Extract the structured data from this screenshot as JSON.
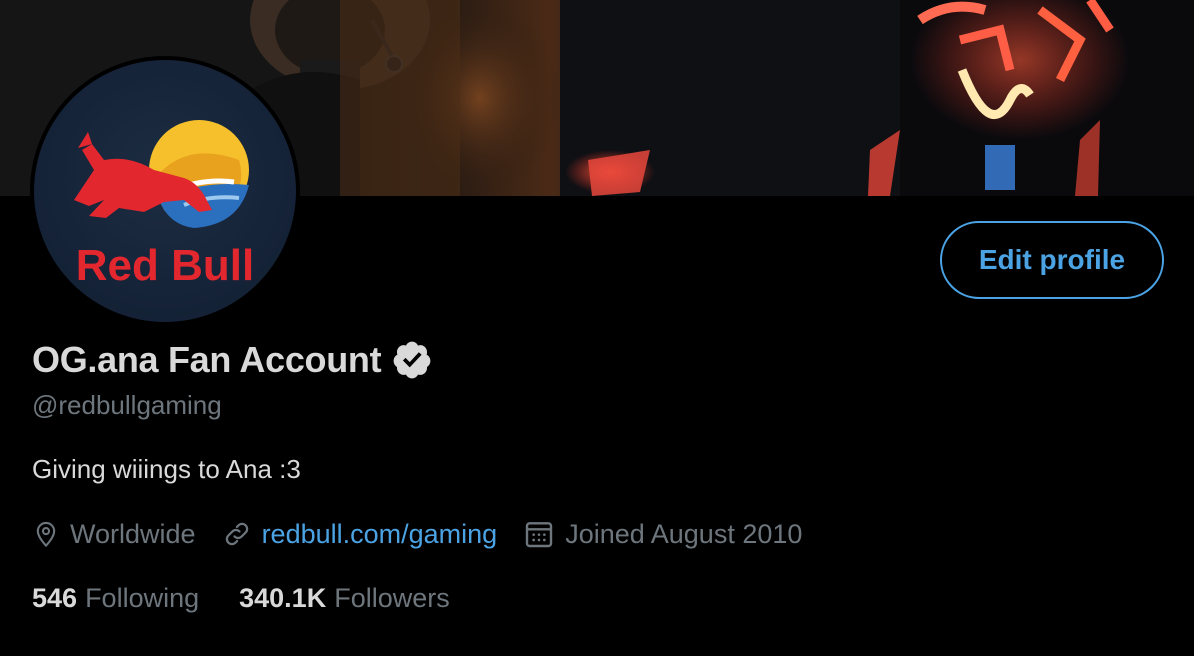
{
  "profile": {
    "display_name": "OG.ana Fan Account",
    "handle": "@redbullgaming",
    "bio": "Giving wiiings to Ana :3",
    "verified": true,
    "avatar_logo_text": "Red Bull"
  },
  "actions": {
    "edit_profile_label": "Edit profile"
  },
  "meta": {
    "location": "Worldwide",
    "website": "redbull.com/gaming",
    "joined": "Joined August 2010"
  },
  "stats": {
    "following_count": "546",
    "following_label": "Following",
    "followers_count": "340.1K",
    "followers_label": "Followers"
  },
  "icons": {
    "location": "map-pin-icon",
    "link": "link-icon",
    "calendar": "calendar-icon",
    "verified": "verified-badge-icon"
  },
  "colors": {
    "background": "#000000",
    "accent": "#4ba3e3",
    "primary_text": "#d9d9d9",
    "secondary_text": "#6e767d"
  }
}
